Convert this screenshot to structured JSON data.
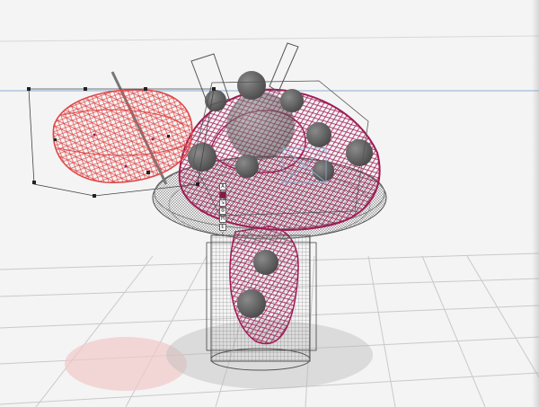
{
  "viewport": {
    "label": "3D viewport",
    "colors": {
      "background": "#f4f4f4",
      "grid": "#c9c9c9",
      "horizon_line": "#8aaed6",
      "selected_wire": "#e04848",
      "hat_wire": "#a01a55",
      "mesh_wire": "#6b6b6b",
      "sphere": "#5a5a5a",
      "bounding_box": "#444444"
    }
  },
  "manipulator": {
    "buttons": [
      {
        "label": "A",
        "icon": "axis-icon",
        "active": false
      },
      {
        "label": "",
        "icon": "color-swatch-icon",
        "active": true
      },
      {
        "label": "⇲",
        "icon": "scale-icon",
        "active": false
      },
      {
        "label": "⚙",
        "icon": "settings-icon",
        "active": false
      },
      {
        "label": "M",
        "icon": "move-icon",
        "active": false
      },
      {
        "label": "E",
        "icon": "edit-icon",
        "active": false
      }
    ],
    "arrow": "↓"
  }
}
